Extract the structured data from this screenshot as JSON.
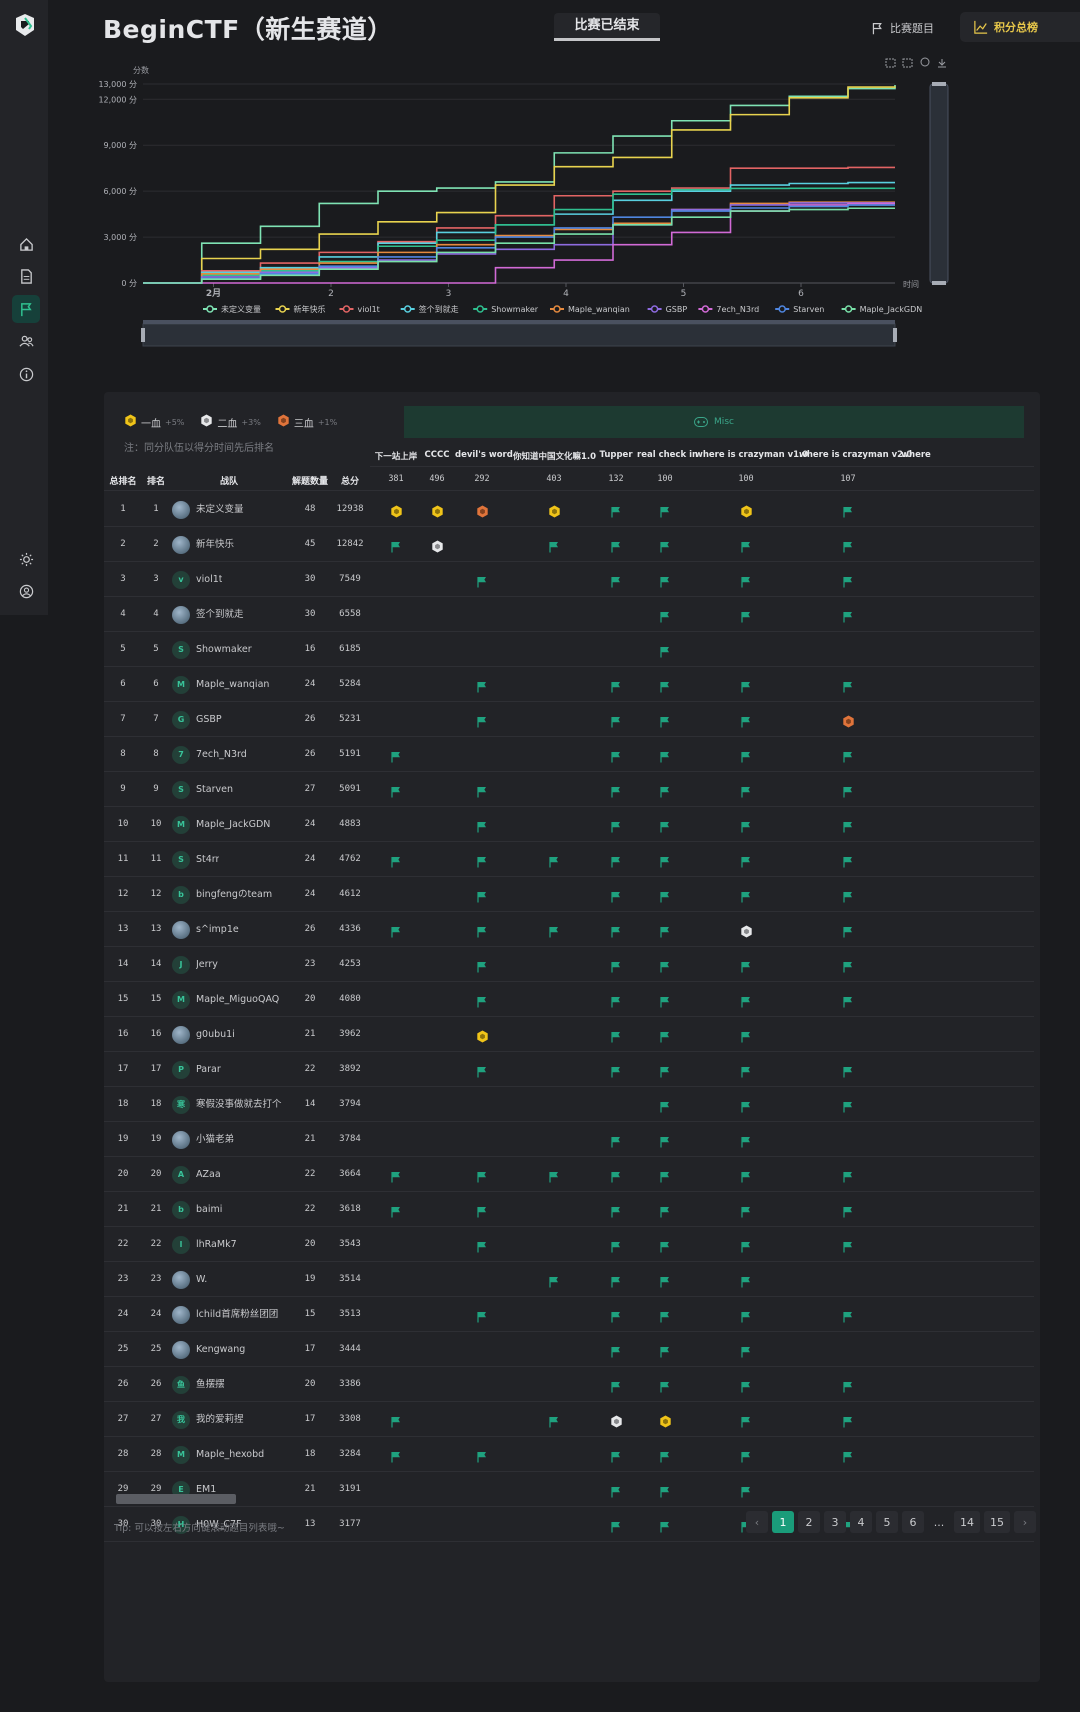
{
  "app": {
    "title": "BeginCTF（新生赛道）",
    "status_tab": "比赛已结束",
    "nav": {
      "challenges": "比赛题目",
      "scoreboard": "积分总榜"
    }
  },
  "sidebar": {
    "icons": [
      "logo-icon",
      "home-icon",
      "document-icon",
      "flag-icon",
      "users-icon",
      "info-icon",
      "sun-icon",
      "user-icon"
    ]
  },
  "chart_data": {
    "type": "line",
    "title": "",
    "xlabel": "时间",
    "ylabel": "分数",
    "y_ticks": [
      "0 分",
      "3,000 分",
      "6,000 分",
      "9,000 分",
      "12,000 分",
      "13,000 分"
    ],
    "x_ticks": [
      "2月",
      "2",
      "3",
      "4",
      "5",
      "6"
    ],
    "x": [
      0,
      0.5,
      1,
      1.5,
      2,
      2.5,
      3,
      3.5,
      4,
      4.5,
      5,
      5.5,
      6,
      6.4
    ],
    "ylim": [
      0,
      13000
    ],
    "legend_position": "bottom",
    "series": [
      {
        "name": "未定义变量",
        "color": "#7fe3b4",
        "values": [
          0,
          2600,
          3700,
          5200,
          6000,
          6200,
          6600,
          8500,
          9600,
          10600,
          11600,
          12200,
          12700,
          12938
        ]
      },
      {
        "name": "新年快乐",
        "color": "#e8d34f",
        "values": [
          0,
          1600,
          2200,
          3200,
          4000,
          4600,
          6400,
          7600,
          8200,
          10000,
          11000,
          12100,
          12800,
          12842
        ]
      },
      {
        "name": "viol1t",
        "color": "#e26464",
        "values": [
          0,
          800,
          1300,
          2000,
          2700,
          3600,
          4400,
          5700,
          6000,
          6200,
          7500,
          7500,
          7549,
          7549
        ]
      },
      {
        "name": "签个到就走",
        "color": "#59d0e0",
        "values": [
          0,
          700,
          1000,
          1700,
          2600,
          3300,
          3800,
          4500,
          5400,
          6000,
          6400,
          6500,
          6558,
          6558
        ]
      },
      {
        "name": "Showmaker",
        "color": "#2fbf8f",
        "values": [
          0,
          500,
          800,
          1400,
          2400,
          2800,
          3800,
          4800,
          5800,
          6100,
          6180,
          6185,
          6185,
          6185
        ]
      },
      {
        "name": "Maple_wanqian",
        "color": "#e58a3f",
        "values": [
          0,
          600,
          900,
          1300,
          2000,
          2500,
          3100,
          3500,
          3900,
          4800,
          5200,
          5284,
          5284,
          5284
        ]
      },
      {
        "name": "GSBP",
        "color": "#8e6be0",
        "values": [
          0,
          400,
          700,
          1000,
          1500,
          1900,
          2200,
          2500,
          3800,
          4800,
          5100,
          5231,
          5231,
          5231
        ]
      },
      {
        "name": "7ech_N3rd",
        "color": "#d16ad6",
        "values": [
          0,
          0,
          0,
          0,
          0,
          0,
          1000,
          1500,
          2500,
          3300,
          4700,
          5100,
          5191,
          5191
        ]
      },
      {
        "name": "Starven",
        "color": "#4f86e0",
        "values": [
          0,
          300,
          600,
          1100,
          1700,
          2300,
          3000,
          3600,
          4300,
          4700,
          4900,
          5000,
          5091,
          5091
        ]
      },
      {
        "name": "Maple_JackGDN",
        "color": "#78e0a8",
        "values": [
          0,
          250,
          500,
          900,
          1400,
          2000,
          2600,
          3200,
          3800,
          4300,
          4700,
          4800,
          4883,
          4883
        ]
      }
    ]
  },
  "board": {
    "legend": [
      {
        "label": "一血",
        "bonus": "+5%",
        "icon": "gold-hexagon-icon"
      },
      {
        "label": "二血",
        "bonus": "+3%",
        "icon": "silver-hexagon-icon"
      },
      {
        "label": "三血",
        "bonus": "+1%",
        "icon": "bronze-hexagon-icon"
      }
    ],
    "note": "注：同分队伍以得分时间先后排名",
    "category": "Misc",
    "columns": [
      "总排名",
      "排名",
      "战队",
      "解题数量",
      "总分"
    ],
    "challenges": [
      {
        "name": "下一站上岸",
        "score": "381"
      },
      {
        "name": "CCCC",
        "score": "496"
      },
      {
        "name": "devil's word",
        "score": "292"
      },
      {
        "name": "你知道中国文化嘛1.0",
        "score": "403"
      },
      {
        "name": "Tupper",
        "score": "132"
      },
      {
        "name": "real check in",
        "score": "100"
      },
      {
        "name": "where is crazyman v1.0",
        "score": "100"
      },
      {
        "name": "where is crazyman v2.0",
        "score": "107"
      },
      {
        "name": "where",
        "score": ""
      }
    ],
    "rows": [
      {
        "total_rank": "1",
        "rank": "1",
        "team": "未定义变量",
        "avatar": "",
        "avatar_img": true,
        "solved": "48",
        "score": "12938",
        "marks": [
          "gold",
          "gold",
          "bronze",
          "gold",
          "flag",
          "flag",
          "gold",
          "flag",
          ""
        ]
      },
      {
        "total_rank": "2",
        "rank": "2",
        "team": "新年快乐",
        "avatar": "",
        "avatar_img": true,
        "solved": "45",
        "score": "12842",
        "marks": [
          "flag",
          "silver",
          "",
          "flag",
          "flag",
          "flag",
          "flag",
          "flag",
          ""
        ]
      },
      {
        "total_rank": "3",
        "rank": "3",
        "team": "viol1t",
        "avatar": "v",
        "solved": "30",
        "score": "7549",
        "marks": [
          "",
          "",
          "flag",
          "",
          "flag",
          "flag",
          "flag",
          "flag",
          ""
        ]
      },
      {
        "total_rank": "4",
        "rank": "4",
        "team": "签个到就走",
        "avatar": "",
        "avatar_img": true,
        "solved": "30",
        "score": "6558",
        "marks": [
          "",
          "",
          "",
          "",
          "",
          "flag",
          "flag",
          "flag",
          ""
        ]
      },
      {
        "total_rank": "5",
        "rank": "5",
        "team": "Showmaker",
        "avatar": "S",
        "solved": "16",
        "score": "6185",
        "marks": [
          "",
          "",
          "",
          "",
          "",
          "flag",
          "",
          "",
          ""
        ]
      },
      {
        "total_rank": "6",
        "rank": "6",
        "team": "Maple_wanqian",
        "avatar": "M",
        "solved": "24",
        "score": "5284",
        "marks": [
          "",
          "",
          "flag",
          "",
          "flag",
          "flag",
          "flag",
          "flag",
          ""
        ]
      },
      {
        "total_rank": "7",
        "rank": "7",
        "team": "GSBP",
        "avatar": "G",
        "solved": "26",
        "score": "5231",
        "marks": [
          "",
          "",
          "flag",
          "",
          "flag",
          "flag",
          "flag",
          "bronze",
          ""
        ]
      },
      {
        "total_rank": "8",
        "rank": "8",
        "team": "7ech_N3rd",
        "avatar": "7",
        "solved": "26",
        "score": "5191",
        "marks": [
          "flag",
          "",
          "",
          "",
          "flag",
          "flag",
          "flag",
          "flag",
          ""
        ]
      },
      {
        "total_rank": "9",
        "rank": "9",
        "team": "Starven",
        "avatar": "S",
        "solved": "27",
        "score": "5091",
        "marks": [
          "flag",
          "",
          "flag",
          "",
          "flag",
          "flag",
          "flag",
          "flag",
          ""
        ]
      },
      {
        "total_rank": "10",
        "rank": "10",
        "team": "Maple_JackGDN",
        "avatar": "M",
        "solved": "24",
        "score": "4883",
        "marks": [
          "",
          "",
          "flag",
          "",
          "flag",
          "flag",
          "flag",
          "flag",
          ""
        ]
      },
      {
        "total_rank": "11",
        "rank": "11",
        "team": "St4rr",
        "avatar": "S",
        "solved": "24",
        "score": "4762",
        "marks": [
          "flag",
          "",
          "flag",
          "flag",
          "flag",
          "flag",
          "flag",
          "flag",
          ""
        ]
      },
      {
        "total_rank": "12",
        "rank": "12",
        "team": "bingfengのteam",
        "avatar": "b",
        "solved": "24",
        "score": "4612",
        "marks": [
          "",
          "",
          "flag",
          "",
          "flag",
          "flag",
          "flag",
          "flag",
          ""
        ]
      },
      {
        "total_rank": "13",
        "rank": "13",
        "team": "s^imp1e",
        "avatar": "",
        "avatar_img": true,
        "solved": "26",
        "score": "4336",
        "marks": [
          "flag",
          "",
          "flag",
          "flag",
          "flag",
          "flag",
          "silver",
          "flag",
          ""
        ]
      },
      {
        "total_rank": "14",
        "rank": "14",
        "team": "Jerry",
        "avatar": "J",
        "solved": "23",
        "score": "4253",
        "marks": [
          "",
          "",
          "flag",
          "",
          "flag",
          "flag",
          "flag",
          "flag",
          ""
        ]
      },
      {
        "total_rank": "15",
        "rank": "15",
        "team": "Maple_MiguoQAQ",
        "avatar": "M",
        "solved": "20",
        "score": "4080",
        "marks": [
          "",
          "",
          "flag",
          "",
          "flag",
          "flag",
          "flag",
          "flag",
          ""
        ]
      },
      {
        "total_rank": "16",
        "rank": "16",
        "team": "g0ubu1i",
        "avatar": "",
        "avatar_img": true,
        "solved": "21",
        "score": "3962",
        "marks": [
          "",
          "",
          "gold",
          "",
          "flag",
          "flag",
          "flag",
          "",
          ""
        ]
      },
      {
        "total_rank": "17",
        "rank": "17",
        "team": "Parar",
        "avatar": "P",
        "solved": "22",
        "score": "3892",
        "marks": [
          "",
          "",
          "flag",
          "",
          "flag",
          "flag",
          "flag",
          "flag",
          ""
        ]
      },
      {
        "total_rank": "18",
        "rank": "18",
        "team": "寒假没事做就去打个",
        "avatar": "寒",
        "solved": "14",
        "score": "3794",
        "marks": [
          "",
          "",
          "",
          "",
          "",
          "flag",
          "flag",
          "flag",
          ""
        ]
      },
      {
        "total_rank": "19",
        "rank": "19",
        "team": "小猫老弟",
        "avatar": "",
        "avatar_img": true,
        "solved": "21",
        "score": "3784",
        "marks": [
          "",
          "",
          "",
          "",
          "flag",
          "flag",
          "flag",
          "",
          ""
        ]
      },
      {
        "total_rank": "20",
        "rank": "20",
        "team": "AZaa",
        "avatar": "A",
        "solved": "22",
        "score": "3664",
        "marks": [
          "flag",
          "",
          "flag",
          "flag",
          "flag",
          "flag",
          "flag",
          "flag",
          ""
        ]
      },
      {
        "total_rank": "21",
        "rank": "21",
        "team": "baimi",
        "avatar": "b",
        "solved": "22",
        "score": "3618",
        "marks": [
          "flag",
          "",
          "flag",
          "",
          "flag",
          "flag",
          "flag",
          "flag",
          ""
        ]
      },
      {
        "total_rank": "22",
        "rank": "22",
        "team": "lhRaMk7",
        "avatar": "l",
        "solved": "20",
        "score": "3543",
        "marks": [
          "",
          "",
          "flag",
          "",
          "flag",
          "flag",
          "flag",
          "flag",
          ""
        ]
      },
      {
        "total_rank": "23",
        "rank": "23",
        "team": "W.",
        "avatar": "",
        "avatar_img": true,
        "solved": "19",
        "score": "3514",
        "marks": [
          "",
          "",
          "",
          "flag",
          "flag",
          "flag",
          "flag",
          "",
          ""
        ]
      },
      {
        "total_rank": "24",
        "rank": "24",
        "team": "lchild首席粉丝团团",
        "avatar": "",
        "avatar_img": true,
        "solved": "15",
        "score": "3513",
        "marks": [
          "",
          "",
          "flag",
          "",
          "flag",
          "flag",
          "flag",
          "flag",
          ""
        ]
      },
      {
        "total_rank": "25",
        "rank": "25",
        "team": "Kengwang",
        "avatar": "",
        "avatar_img": true,
        "solved": "17",
        "score": "3444",
        "marks": [
          "",
          "",
          "",
          "",
          "flag",
          "flag",
          "flag",
          "",
          ""
        ]
      },
      {
        "total_rank": "26",
        "rank": "26",
        "team": "鱼摆摆",
        "avatar": "鱼",
        "solved": "20",
        "score": "3386",
        "marks": [
          "",
          "",
          "",
          "",
          "flag",
          "flag",
          "flag",
          "flag",
          ""
        ]
      },
      {
        "total_rank": "27",
        "rank": "27",
        "team": "我的爱莉捏",
        "avatar": "我",
        "solved": "17",
        "score": "3308",
        "marks": [
          "flag",
          "",
          "",
          "flag",
          "silver",
          "gold",
          "flag",
          "flag",
          ""
        ]
      },
      {
        "total_rank": "28",
        "rank": "28",
        "team": "Maple_hexobd",
        "avatar": "M",
        "solved": "18",
        "score": "3284",
        "marks": [
          "flag",
          "",
          "flag",
          "",
          "flag",
          "flag",
          "flag",
          "flag",
          ""
        ]
      },
      {
        "total_rank": "29",
        "rank": "29",
        "team": "EM1",
        "avatar": "E",
        "solved": "21",
        "score": "3191",
        "marks": [
          "",
          "",
          "",
          "",
          "flag",
          "flag",
          "flag",
          "",
          ""
        ]
      },
      {
        "total_rank": "30",
        "rank": "30",
        "team": "H0W_C7F",
        "avatar": "H",
        "solved": "13",
        "score": "3177",
        "marks": [
          "",
          "",
          "",
          "",
          "flag",
          "flag",
          "flag",
          "flag",
          ""
        ]
      }
    ],
    "tip": "Tip: 可以按左右方向键滚动题目列表哦~",
    "pagination": {
      "pages": [
        "1",
        "2",
        "3",
        "4",
        "5",
        "6",
        "...",
        "14",
        "15"
      ],
      "current": "1",
      "prev": "‹",
      "next": "›"
    }
  }
}
